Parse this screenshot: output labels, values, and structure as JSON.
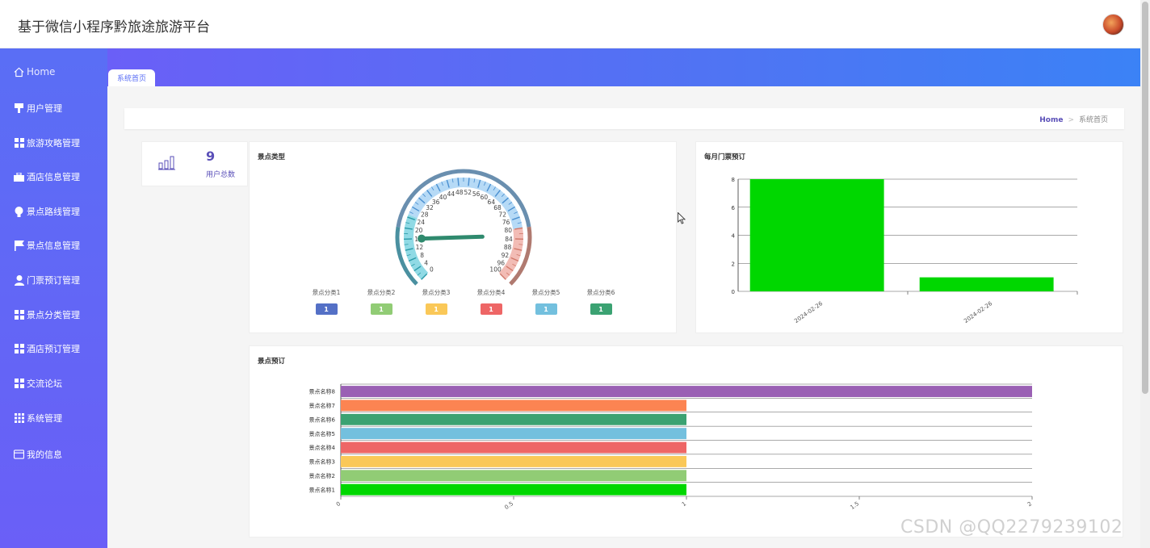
{
  "app": {
    "title": "基于微信小程序黔旅途旅游平台"
  },
  "sidebar": {
    "items": [
      {
        "label": "Home"
      },
      {
        "label": "用户管理"
      },
      {
        "label": "旅游攻略管理"
      },
      {
        "label": "酒店信息管理"
      },
      {
        "label": "景点路线管理"
      },
      {
        "label": "景点信息管理"
      },
      {
        "label": "门票预订管理"
      },
      {
        "label": "景点分类管理"
      },
      {
        "label": "酒店预订管理"
      },
      {
        "label": "交流论坛"
      },
      {
        "label": "系统管理"
      },
      {
        "label": "我的信息"
      }
    ]
  },
  "tabs": [
    {
      "label": "系统首页"
    }
  ],
  "breadcrumb": {
    "home": "Home",
    "current": "系统首页"
  },
  "stat": {
    "value": "9",
    "label": "用户总数"
  },
  "gauge": {
    "title": "景点类型",
    "ticks": [
      "0",
      "4",
      "8",
      "12",
      "16",
      "20",
      "24",
      "28",
      "32",
      "36",
      "40",
      "44",
      "48",
      "52",
      "56",
      "60",
      "64",
      "68",
      "72",
      "76",
      "80",
      "84",
      "88",
      "92",
      "96",
      "100"
    ],
    "value": 16,
    "legend": [
      {
        "name": "景点分类1",
        "value": "1",
        "color": "#5470c6"
      },
      {
        "name": "景点分类2",
        "value": "1",
        "color": "#91cc75"
      },
      {
        "name": "景点分类3",
        "value": "1",
        "color": "#fac858"
      },
      {
        "name": "景点分类4",
        "value": "1",
        "color": "#ee6666"
      },
      {
        "name": "景点分类5",
        "value": "1",
        "color": "#73c0de"
      },
      {
        "name": "景点分类6",
        "value": "1",
        "color": "#3ba272"
      }
    ]
  },
  "chart_data": [
    {
      "type": "bar",
      "title": "每月门票预订",
      "categories": [
        "2024-02-26",
        "2024-02-26"
      ],
      "values": [
        8,
        1
      ],
      "yticks": [
        "0",
        "2",
        "4",
        "6",
        "8"
      ],
      "ylim": [
        0,
        8
      ],
      "color": "#00d700"
    },
    {
      "type": "bar",
      "orientation": "horizontal",
      "title": "景点预订",
      "categories": [
        "景点名称1",
        "景点名称2",
        "景点名称3",
        "景点名称4",
        "景点名称5",
        "景点名称6",
        "景点名称7",
        "景点名称8"
      ],
      "values": [
        1,
        1,
        1,
        1,
        1,
        1,
        1,
        2
      ],
      "colors": [
        "#00d700",
        "#91cc75",
        "#fac858",
        "#ee6666",
        "#73c0de",
        "#3ba272",
        "#fc8452",
        "#9a60b4"
      ],
      "xticks": [
        "0",
        "0.5",
        "1",
        "1.5",
        "2"
      ],
      "xlim": [
        0,
        2
      ]
    }
  ],
  "watermark": "CSDN @QQ2279239102"
}
